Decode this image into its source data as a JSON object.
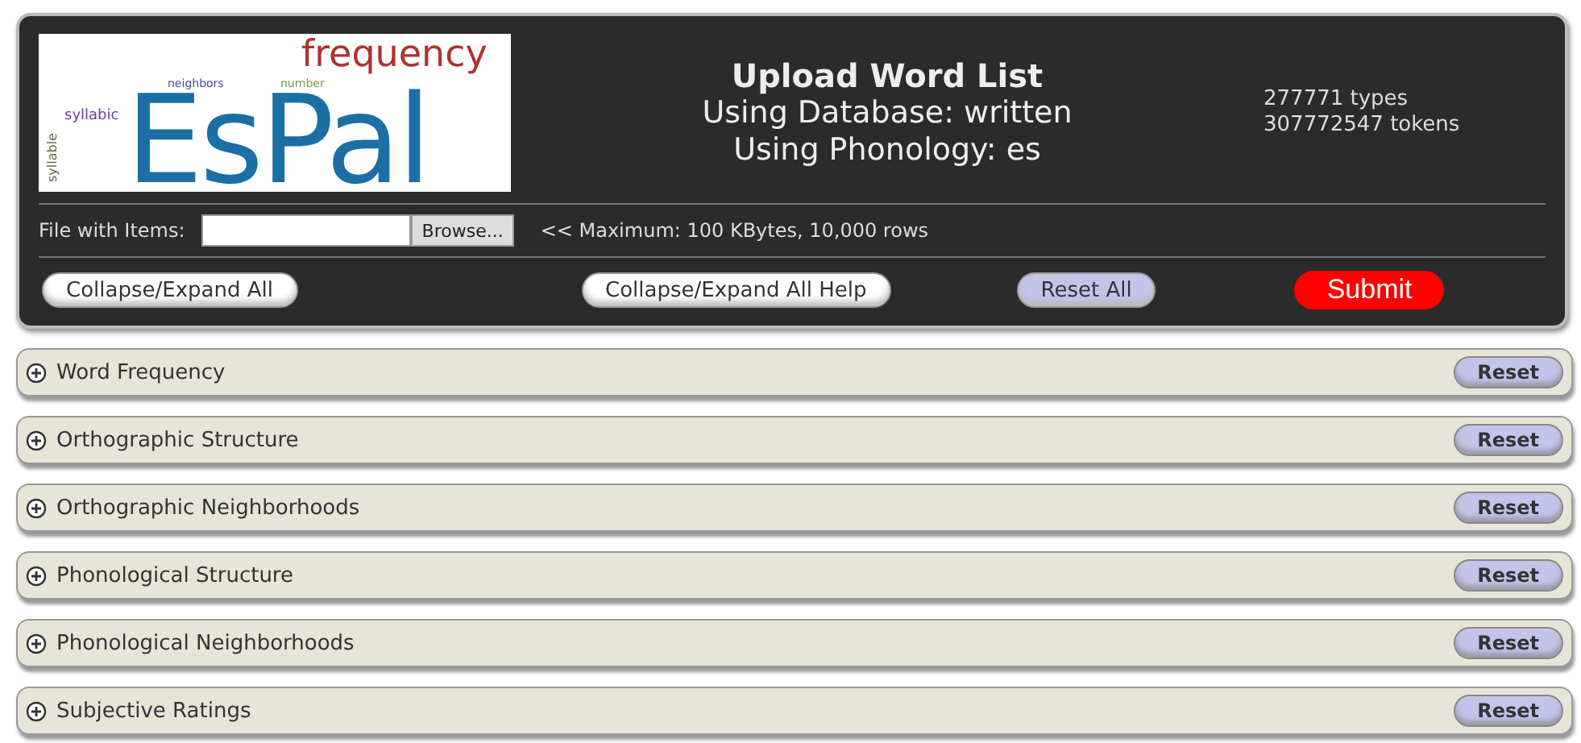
{
  "logo": {
    "words": [
      {
        "text": "frequency",
        "kind": "top"
      },
      {
        "text": "neighbors",
        "kind": "small"
      },
      {
        "text": "number",
        "kind": "small"
      },
      {
        "text": "syllabic",
        "kind": "side"
      },
      {
        "text": "EsPal",
        "kind": "main"
      },
      {
        "text": "syllable",
        "kind": "vertical"
      }
    ]
  },
  "header": {
    "title": "Upload Word List",
    "lines": [
      "Using Database: written",
      "Using Phonology: es"
    ],
    "stats": [
      "277771 types",
      "307772547 tokens"
    ]
  },
  "file_row": {
    "label": "File with Items:",
    "browse": "Browse...",
    "note": "<< Maximum: 100 KBytes, 10,000 rows"
  },
  "actions": [
    {
      "label": "Collapse/Expand All",
      "kind": "plain"
    },
    {
      "label": "Collapse/Expand All Help",
      "kind": "plain"
    },
    {
      "label": "Reset All",
      "kind": "reset"
    },
    {
      "label": "Submit",
      "kind": "submit"
    }
  ],
  "sections": [
    {
      "title": "Word Frequency",
      "expanded": false,
      "reset": "Reset"
    },
    {
      "title": "Orthographic Structure",
      "expanded": false,
      "reset": "Reset"
    },
    {
      "title": "Orthographic Neighborhoods",
      "expanded": false,
      "reset": "Reset"
    },
    {
      "title": "Phonological Structure",
      "expanded": false,
      "reset": "Reset"
    },
    {
      "title": "Phonological Neighborhoods",
      "expanded": false,
      "reset": "Reset"
    },
    {
      "title": "Subjective Ratings",
      "expanded": false,
      "reset": "Reset"
    }
  ]
}
